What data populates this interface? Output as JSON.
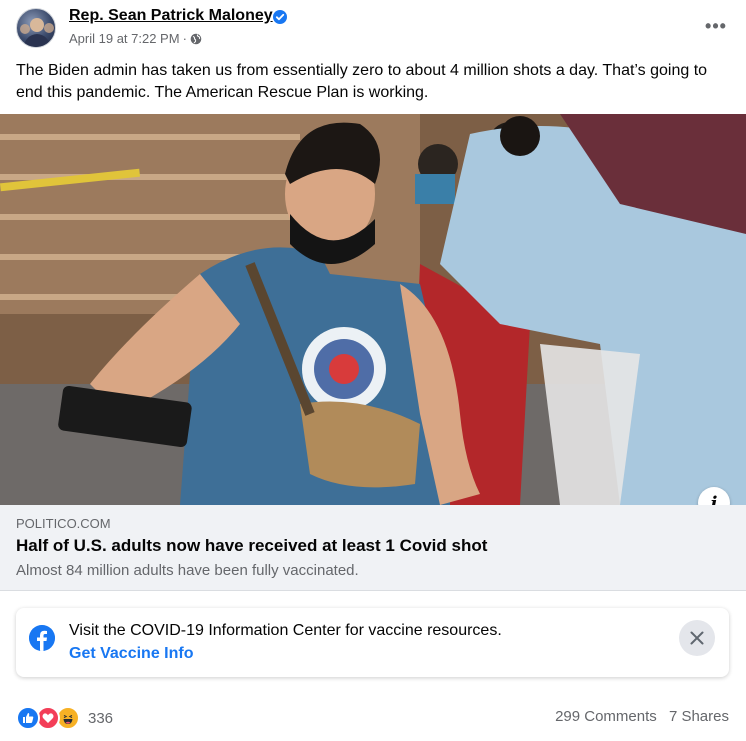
{
  "post": {
    "author": "Rep. Sean Patrick Maloney",
    "date": "April 19 at 7:22 PM",
    "separator": "·",
    "privacy_icon": "globe-icon",
    "more_label": "•••",
    "text": "The Biden admin has taken us from essentially zero to about 4 million shots a day. That’s going to end this pandemic. The American Rescue Plan is working."
  },
  "link_preview": {
    "domain": "POLITICO.COM",
    "title": "Half of U.S. adults now have received at least 1 Covid shot",
    "subtitle": "Almost 84 million adults have been fully vaccinated.",
    "info_label": "i"
  },
  "covid_card": {
    "text": "Visit the COVID-19 Information Center for vaccine resources.",
    "link": "Get Vaccine Info",
    "icon": "facebook-icon",
    "close_icon": "close-icon"
  },
  "footer": {
    "reaction_icons": [
      "like-icon",
      "love-icon",
      "haha-icon"
    ],
    "reaction_count": "336",
    "comments": "299 Comments",
    "shares": "7 Shares"
  },
  "colors": {
    "accent": "#1877f2",
    "secondary_text": "#65676b",
    "love": "#f33e58",
    "haha": "#f7b125"
  }
}
